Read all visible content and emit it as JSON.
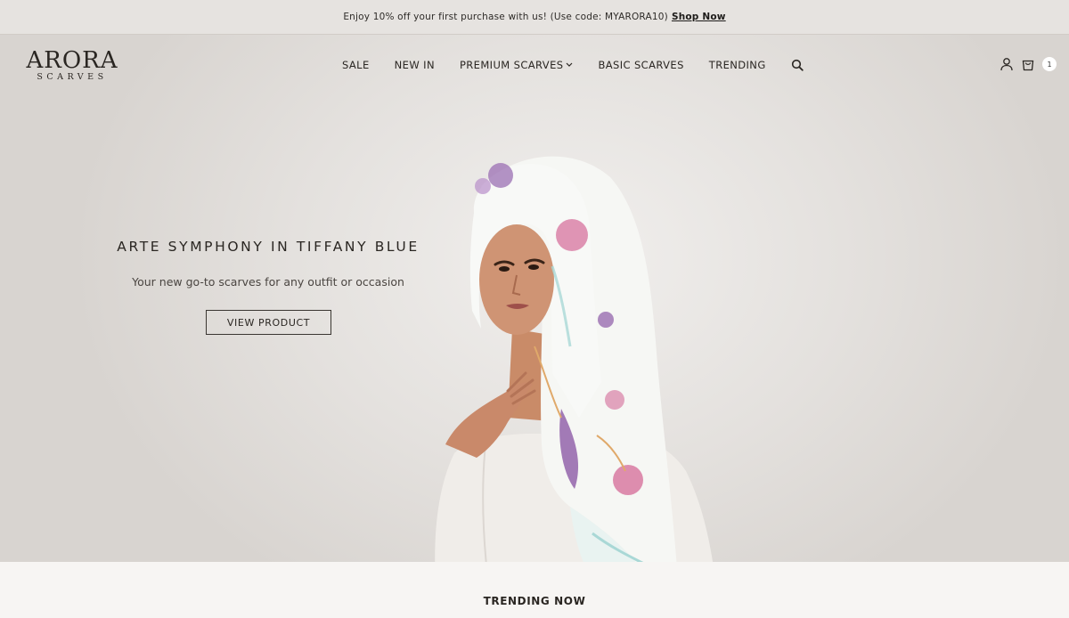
{
  "announcement": {
    "text": "Enjoy 10% off your first purchase with us! (Use code: MYARORA10)",
    "link_label": "Shop Now"
  },
  "brand": {
    "name": "ARORA",
    "sub": "SCARVES"
  },
  "nav": {
    "items": [
      "SALE",
      "NEW IN",
      "PREMIUM SCARVES",
      "BASIC SCARVES",
      "TRENDING"
    ]
  },
  "cart": {
    "count": "1"
  },
  "hero": {
    "title": "ARTE SYMPHONY IN TIFFANY BLUE",
    "subtitle": "Your new go-to scarves for any outfit or occasion",
    "button_label": "VIEW PRODUCT"
  },
  "trending": {
    "title": "TRENDING NOW"
  },
  "icons": {
    "search": "search-icon",
    "account": "user-icon",
    "cart": "shopping-bag-icon",
    "dropdown": "chevron-down-icon"
  },
  "colors": {
    "background": "#e3e0dd",
    "text": "#2a2622",
    "scarf_pink": "#d46a97",
    "scarf_purple": "#8d5aa6",
    "scarf_teal": "#a9d8d6"
  }
}
